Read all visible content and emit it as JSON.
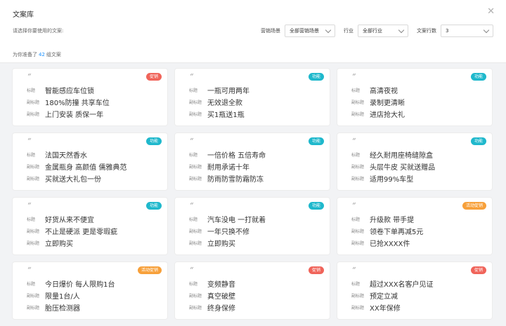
{
  "header": {
    "title": "文案库",
    "close_icon": "close-icon",
    "hint": "请选择你要使用的文案:"
  },
  "filters": {
    "scene_label": "营销场景",
    "scene_value": "全部营销场景",
    "industry_label": "行业",
    "industry_value": "全部行业",
    "lines_label": "文案行数",
    "lines_value": "3"
  },
  "summary": {
    "prefix": "为你准备了",
    "count": "42",
    "suffix": "组文案"
  },
  "colors": {
    "red": "#f0645a",
    "teal": "#1fb8cc",
    "orange": "#f7a03a",
    "accent": "#1890ff"
  },
  "cards": [
    {
      "badge": "促销",
      "badge_color": "#f0645a",
      "title_label": "标题",
      "title": "智能感应车位锁",
      "sub1_label": "副标题",
      "sub1": "180%防撞 共享车位",
      "sub2_label": "副标题",
      "sub2": "上门安装 质保一年"
    },
    {
      "badge": "功能",
      "badge_color": "#1fb8cc",
      "title_label": "标题",
      "title": "一瓶可用两年",
      "sub1_label": "副标题",
      "sub1": "无效退全款",
      "sub2_label": "副标题",
      "sub2": "买1瓶送1瓶"
    },
    {
      "badge": "功能",
      "badge_color": "#1fb8cc",
      "title_label": "标题",
      "title": "高清夜视",
      "sub1_label": "副标题",
      "sub1": "录制更清晰",
      "sub2_label": "副标题",
      "sub2": "进店抢大礼"
    },
    {
      "badge": "功能",
      "badge_color": "#1fb8cc",
      "title_label": "标题",
      "title": "法国天然香水",
      "sub1_label": "副标题",
      "sub1": "金属瓶身 高颜值 儒雅典范",
      "sub2_label": "副标题",
      "sub2": "买就送大礼包一份"
    },
    {
      "badge": "功能",
      "badge_color": "#1fb8cc",
      "title_label": "标题",
      "title": "一倍价格 五倍寿命",
      "sub1_label": "副标题",
      "sub1": "耐用承诺十年",
      "sub2_label": "副标题",
      "sub2": "防雨防雪防霜防冻"
    },
    {
      "badge": "功能",
      "badge_color": "#1fb8cc",
      "title_label": "标题",
      "title": "经久耐用座椅缝隙盒",
      "sub1_label": "副标题",
      "sub1": "头层牛皮 买就送赠品",
      "sub2_label": "副标题",
      "sub2": "适用99%车型"
    },
    {
      "badge": "功能",
      "badge_color": "#1fb8cc",
      "title_label": "标题",
      "title": "好货从来不便宜",
      "sub1_label": "副标题",
      "sub1": "不止是硬派 更是零瑕疵",
      "sub2_label": "副标题",
      "sub2": "立即购买"
    },
    {
      "badge": "功能",
      "badge_color": "#1fb8cc",
      "title_label": "标题",
      "title": "汽车没电 一打就着",
      "sub1_label": "副标题",
      "sub1": "一年只换不修",
      "sub2_label": "副标题",
      "sub2": "立即购买"
    },
    {
      "badge": "活动促销",
      "badge_color": "#f7a03a",
      "title_label": "标题",
      "title": "升级款 带手提",
      "sub1_label": "副标题",
      "sub1": "领卷下单再减5元",
      "sub2_label": "副标题",
      "sub2": "已抢XXXX件"
    },
    {
      "badge": "活动促销",
      "badge_color": "#f7a03a",
      "title_label": "标题",
      "title": "今日爆价 每人限购1台",
      "sub1_label": "副标题",
      "sub1": "限量1台/人",
      "sub2_label": "副标题",
      "sub2": "胎压检测器"
    },
    {
      "badge": "促销",
      "badge_color": "#f0645a",
      "title_label": "标题",
      "title": "变频静音",
      "sub1_label": "副标题",
      "sub1": "真空破壁",
      "sub2_label": "副标题",
      "sub2": "终身保修"
    },
    {
      "badge": "促销",
      "badge_color": "#f0645a",
      "title_label": "标题",
      "title": "超过XXX名客户见证",
      "sub1_label": "副标题",
      "sub1": "预定立减",
      "sub2_label": "副标题",
      "sub2": "XX年保修"
    }
  ]
}
